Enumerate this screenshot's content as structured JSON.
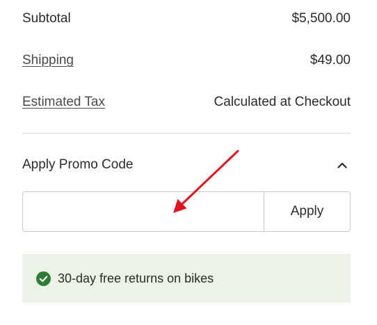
{
  "summary": {
    "subtotal_label": "Subtotal",
    "subtotal_value": "$5,500.00",
    "shipping_label": "Shipping",
    "shipping_value": "$49.00",
    "tax_label": "Estimated Tax",
    "tax_value": "Calculated at Checkout"
  },
  "promo": {
    "header_label": "Apply Promo Code",
    "chevron_icon": "chevron-up-icon",
    "input_value": "",
    "input_placeholder": "",
    "apply_label": "Apply"
  },
  "returns_banner": {
    "icon": "check-circle-icon",
    "text": "30-day free returns on bikes",
    "background_color": "#ebf2e6",
    "icon_color": "#2f7d32"
  },
  "annotation": {
    "icon": "red-arrow-annotation",
    "color": "#e0141e"
  }
}
